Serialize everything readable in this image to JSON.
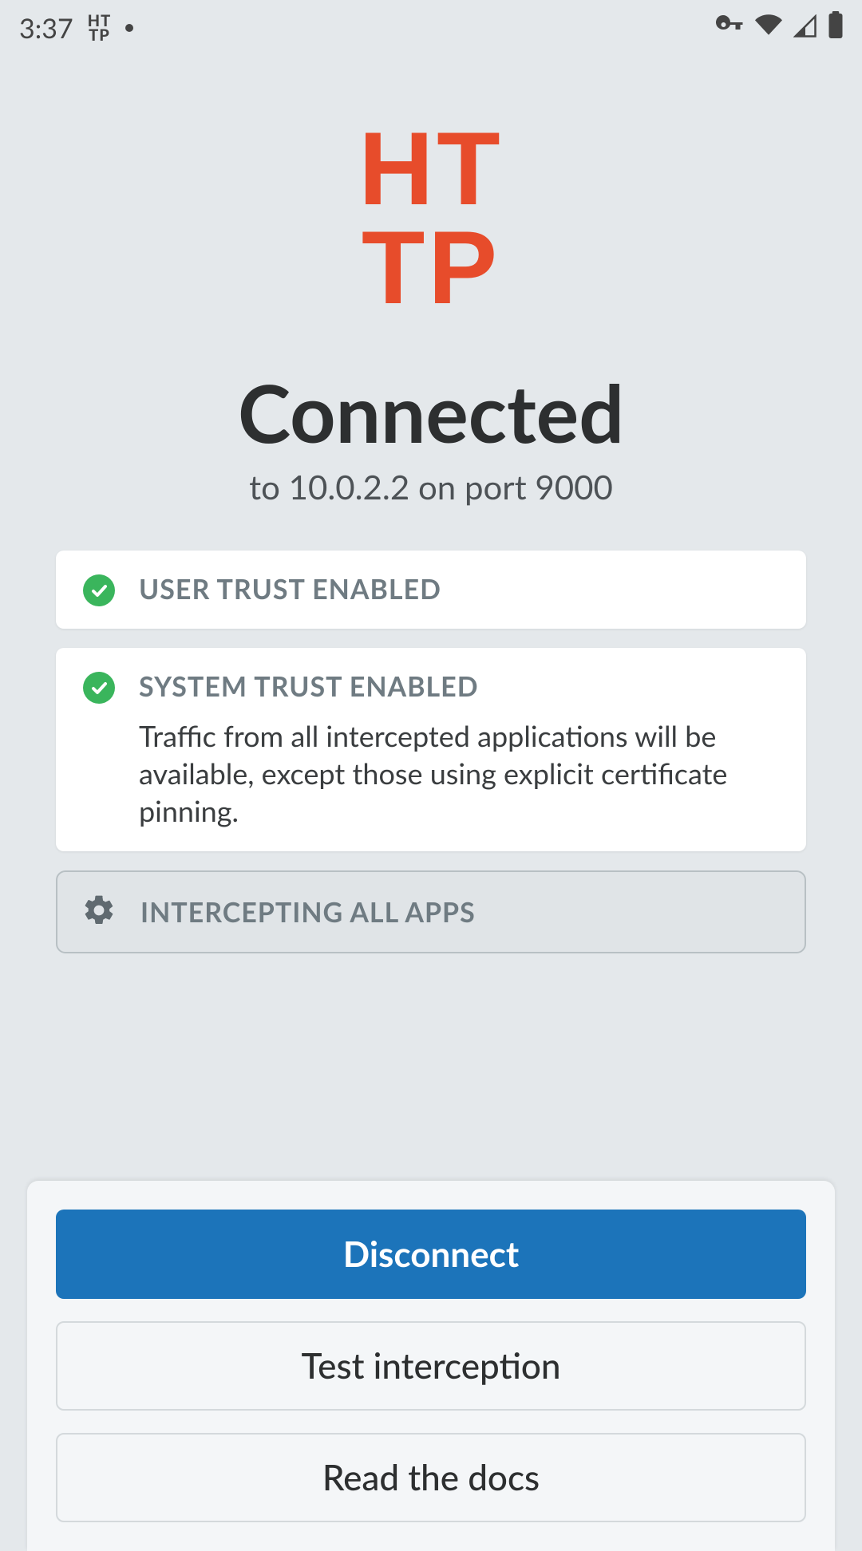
{
  "status_bar": {
    "time": "3:37",
    "app_badge_top": "HT",
    "app_badge_bottom": "TP",
    "notification_dot": true,
    "icons": {
      "vpn": "vpn-key-icon",
      "wifi": "wifi-icon",
      "signal": "cell-signal-icon",
      "battery": "battery-full-icon"
    }
  },
  "logo": {
    "line1": "HT",
    "line2": "TP",
    "color": "#e74c2b"
  },
  "heading": "Connected",
  "subheading": "to 10.0.2.2 on port 9000",
  "cards": {
    "user_trust": {
      "title": "USER TRUST ENABLED",
      "status": "enabled"
    },
    "system_trust": {
      "title": "SYSTEM TRUST ENABLED",
      "status": "enabled",
      "description": "Traffic from all intercepted applications will be available, except those using explicit certificate pinning."
    }
  },
  "intercept_row": {
    "label": "INTERCEPTING ALL APPS",
    "icon": "gear-icon"
  },
  "actions": {
    "disconnect": "Disconnect",
    "test": "Test interception",
    "docs": "Read the docs"
  },
  "colors": {
    "accent": "#e74c2b",
    "success": "#3ab55c",
    "primary_button": "#1c74ba",
    "background": "#e4e8eb"
  }
}
